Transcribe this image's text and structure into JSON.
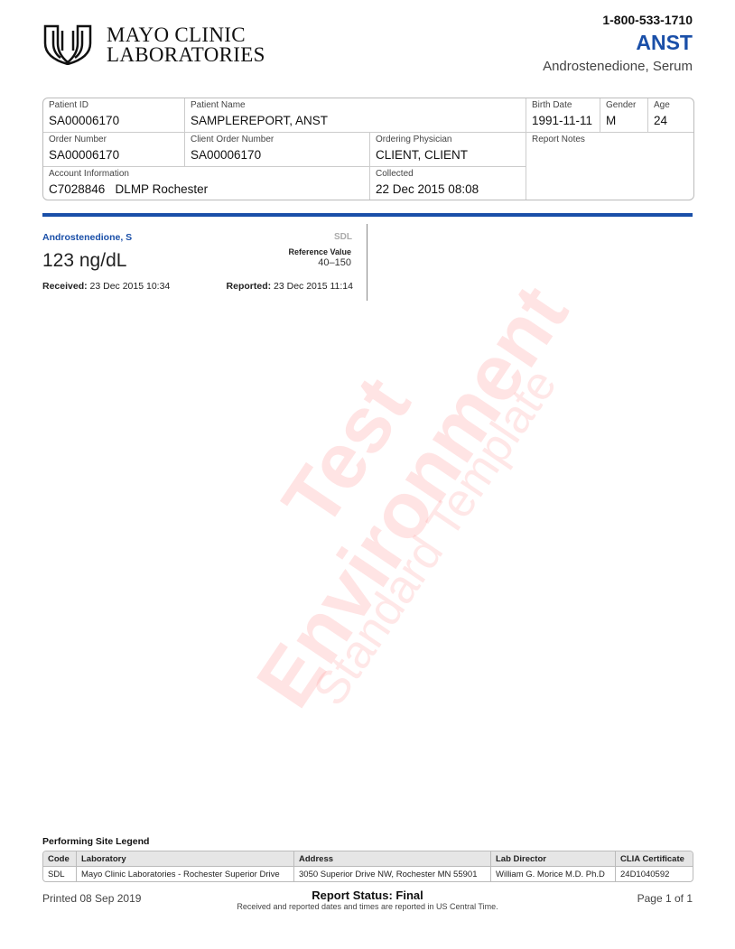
{
  "header": {
    "logo_line1": "MAYO CLINIC",
    "logo_line2": "LABORATORIES",
    "phone": "1-800-533-1710",
    "test_code": "ANST",
    "test_name": "Androstenedione, Serum"
  },
  "patient": {
    "patient_id_label": "Patient ID",
    "patient_id": "SA00006170",
    "patient_name_label": "Patient Name",
    "patient_name": "SAMPLEREPORT, ANST",
    "birth_date_label": "Birth Date",
    "birth_date": "1991-11-11",
    "gender_label": "Gender",
    "gender": "M",
    "age_label": "Age",
    "age": "24",
    "order_number_label": "Order Number",
    "order_number": "SA00006170",
    "client_order_label": "Client Order Number",
    "client_order": "SA00006170",
    "physician_label": "Ordering Physician",
    "physician": "CLIENT, CLIENT",
    "report_notes_label": "Report Notes",
    "account_label": "Account Information",
    "account": "C7028846   DLMP Rochester",
    "collected_label": "Collected",
    "collected": "22 Dec 2015 08:08"
  },
  "result": {
    "name": "Androstenedione, S",
    "site": "SDL",
    "value": "123 ng/dL",
    "ref_label": "Reference Value",
    "ref_value": "40–150",
    "received_label": "Received:",
    "received": "23 Dec 2015 10:34",
    "reported_label": "Reported:",
    "reported": "23 Dec 2015 11:14"
  },
  "watermark": {
    "line1": "Test",
    "line2": "Environment",
    "line3": "Standard Template"
  },
  "legend": {
    "title": "Performing Site Legend",
    "headers": [
      "Code",
      "Laboratory",
      "Address",
      "Lab Director",
      "CLIA Certificate"
    ],
    "row": [
      "SDL",
      "Mayo Clinic Laboratories - Rochester Superior Drive",
      "3050 Superior Drive NW, Rochester MN 55901",
      "William G. Morice M.D. Ph.D",
      "24D1040592"
    ]
  },
  "footer": {
    "printed": "Printed 08 Sep 2019",
    "status": "Report Status: Final",
    "note": "Received and reported dates and times are reported in US Central Time.",
    "page": "Page 1 of 1"
  },
  "colors": {
    "brand_blue": "#1a4fa8",
    "watermark_red": "#ff7878"
  }
}
